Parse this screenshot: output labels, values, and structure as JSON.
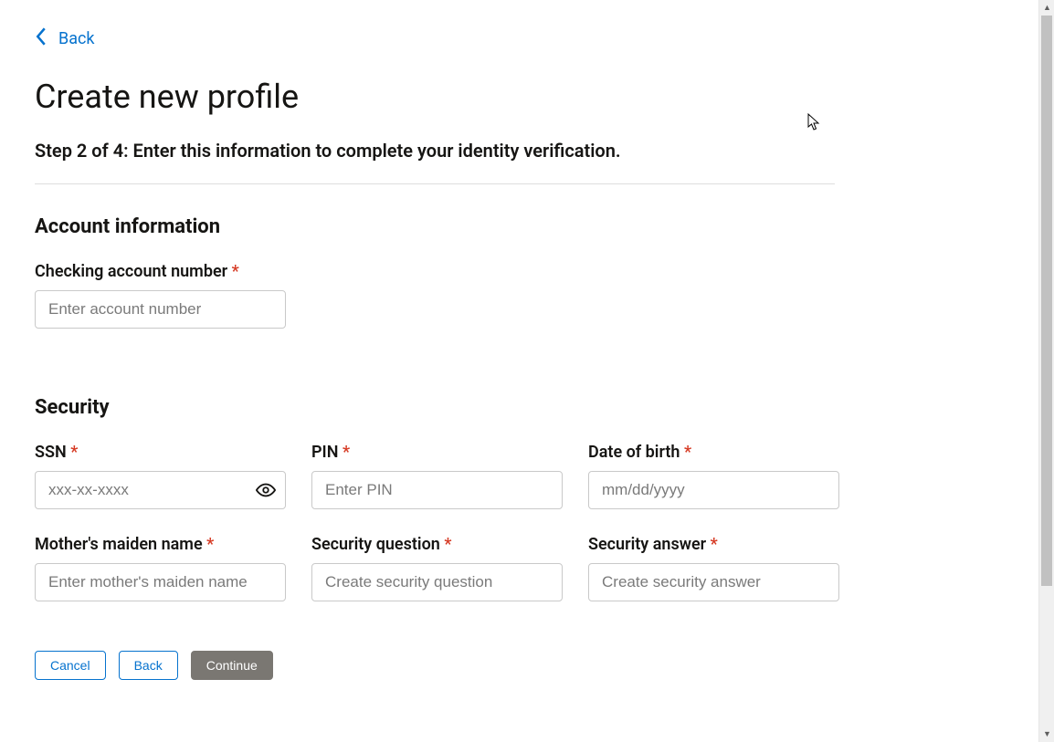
{
  "nav": {
    "back_label": "Back"
  },
  "header": {
    "title": "Create new profile",
    "step_description": "Step 2 of 4: Enter this information to complete your identity verification."
  },
  "sections": {
    "account": {
      "heading": "Account information",
      "fields": {
        "checking_account": {
          "label": "Checking account number",
          "required_mark": "*",
          "placeholder": "Enter account number"
        }
      }
    },
    "security": {
      "heading": "Security",
      "fields": {
        "ssn": {
          "label": "SSN",
          "required_mark": "*",
          "placeholder": "xxx-xx-xxxx"
        },
        "pin": {
          "label": "PIN",
          "required_mark": "*",
          "placeholder": "Enter PIN"
        },
        "dob": {
          "label": "Date of birth",
          "required_mark": "*",
          "placeholder": "mm/dd/yyyy"
        },
        "mother_maiden": {
          "label": "Mother's maiden name",
          "required_mark": "*",
          "placeholder": "Enter mother's maiden name"
        },
        "security_question": {
          "label": "Security question",
          "required_mark": "*",
          "placeholder": "Create security question"
        },
        "security_answer": {
          "label": "Security answer",
          "required_mark": "*",
          "placeholder": "Create security answer"
        }
      }
    }
  },
  "buttons": {
    "cancel": "Cancel",
    "back": "Back",
    "continue": "Continue"
  },
  "colors": {
    "link": "#0572ce",
    "required": "#d63b25",
    "disabled_bg": "#7a7772"
  }
}
